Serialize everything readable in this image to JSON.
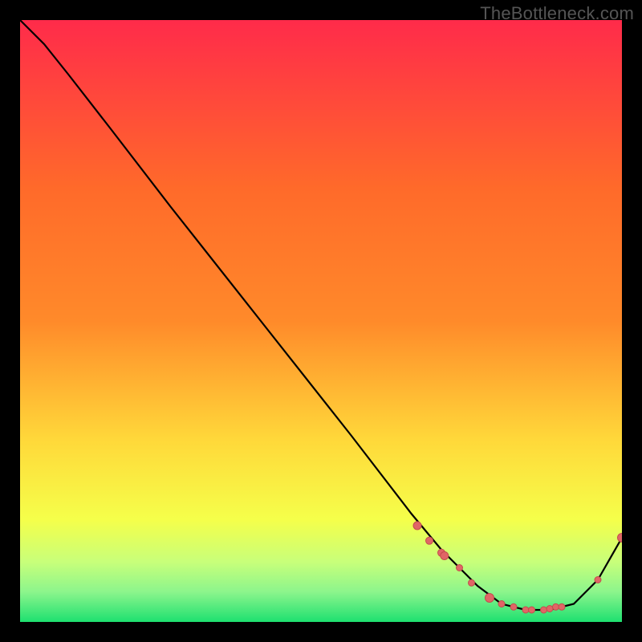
{
  "watermark": "TheBottleneck.com",
  "chart_data": {
    "type": "line",
    "title": "",
    "xlabel": "",
    "ylabel": "",
    "xlim": [
      0,
      100
    ],
    "ylim": [
      0,
      100
    ],
    "grid": false,
    "legend": false,
    "background_gradient": {
      "top": "#ff2b4a",
      "upper_mid": "#ff8a2a",
      "mid": "#ffd93a",
      "lower_mid": "#f5ff4a",
      "green_band_top": "#c8ff7a",
      "bottom": "#1ee070"
    },
    "curve": {
      "x": [
        0,
        4,
        8,
        15,
        25,
        40,
        55,
        65,
        70,
        73,
        76,
        80,
        84,
        88,
        92,
        96,
        100
      ],
      "y": [
        100,
        96,
        91,
        82,
        69,
        50,
        31,
        18,
        12,
        9,
        6,
        3,
        2,
        2,
        3,
        7,
        14
      ]
    },
    "markers": {
      "x": [
        66,
        68,
        70,
        70.5,
        73,
        75,
        78,
        80,
        82,
        84,
        85,
        87,
        88,
        89,
        90,
        96,
        100
      ],
      "y": [
        16,
        13.5,
        11.5,
        11,
        9,
        6.5,
        4,
        3,
        2.5,
        2,
        2,
        2,
        2.2,
        2.5,
        2.5,
        7,
        14
      ],
      "size": [
        5,
        4.5,
        4.5,
        5,
        4,
        4,
        5.5,
        4,
        4,
        4,
        4,
        4,
        4,
        4,
        4,
        4,
        5.5
      ]
    },
    "colors": {
      "line": "#000000",
      "marker_fill": "#e06666",
      "marker_stroke": "#c44d4d"
    }
  }
}
